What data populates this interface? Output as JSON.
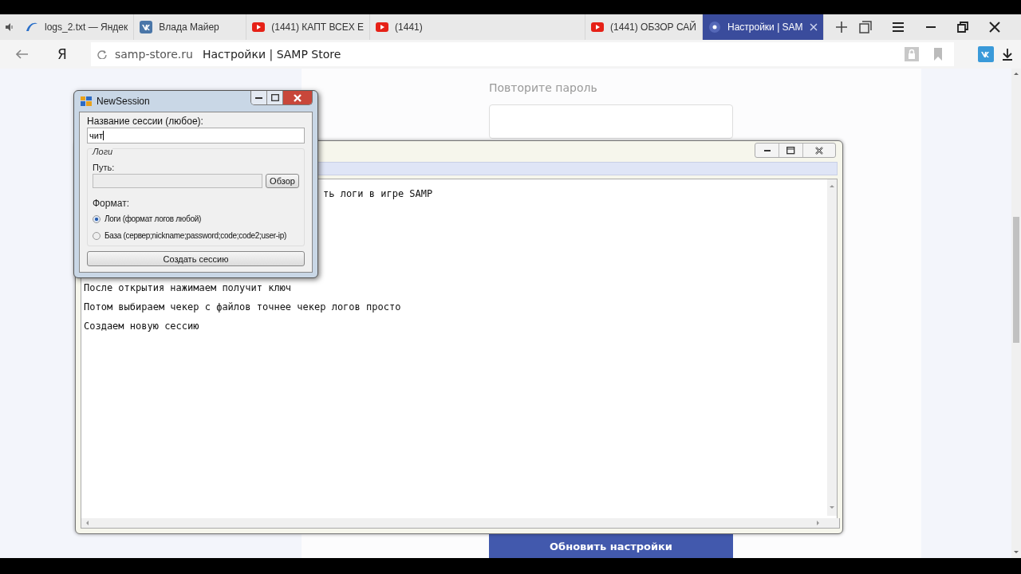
{
  "browser": {
    "tabs": [
      {
        "kind": "document",
        "title": "logs_2.txt — Яндек",
        "selected": false
      },
      {
        "kind": "social",
        "title": "Влада Майер",
        "selected": false
      },
      {
        "kind": "video",
        "title": "(1441) КАПТ ВСЕХ Е",
        "selected": false
      },
      {
        "kind": "video",
        "title": "(1441)",
        "selected": false
      },
      {
        "kind": "video",
        "title": "(1441) ОБЗОР САЙ",
        "selected": false
      },
      {
        "kind": "site",
        "title": "Настройки | SAM",
        "selected": true
      }
    ],
    "address": {
      "logo": "Я",
      "url": "samp-store.ru",
      "page_title": "Настройки | SAMP Store"
    }
  },
  "page": {
    "repeat_password_label": "Повторите пароль",
    "update_button": "Обновить настройки"
  },
  "text_window": {
    "lines": [
      "ть логи в игре SAMP",
      "После открытия нажимаем получит ключ",
      "Потом выбираем чекер с файлов точнее чекер логов просто",
      "Создаем новую сессию"
    ]
  },
  "dialog": {
    "title": "NewSession",
    "name_label": "Название сессии (любое):",
    "name_value": "чит",
    "group_title": "Логи",
    "path_label": "Путь:",
    "browse_button": "Обзор",
    "format_label": "Формат:",
    "formats": [
      {
        "label": "Логи (формат логов любой)",
        "selected": true
      },
      {
        "label": "База (сервер;nickname;password;code;code2;user-ip)",
        "selected": false
      }
    ],
    "create_button": "Создать сессию"
  }
}
